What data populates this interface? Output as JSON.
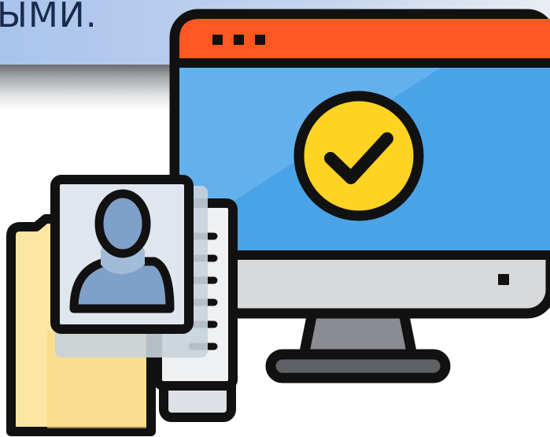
{
  "banner": {
    "text": "ЫМИ."
  },
  "icons": {
    "monitor": "monitor-icon",
    "check": "checkmark-icon",
    "folder": "folder-icon",
    "profile": "user-profile-card-icon",
    "document": "document-icon"
  },
  "colors": {
    "outline": "#111111",
    "titlebar": "#ff5722",
    "screen": "#4aa3e6",
    "screen_light": "#74baf0",
    "check_circle": "#ffd324",
    "bezel": "#d7d9db",
    "stand": "#8a8c91",
    "folder": "#fbe7a3",
    "folder_dark": "#e8c463",
    "card": "#dfe6ee",
    "avatar": "#7fa0c8",
    "paper": "#eef0f2"
  }
}
